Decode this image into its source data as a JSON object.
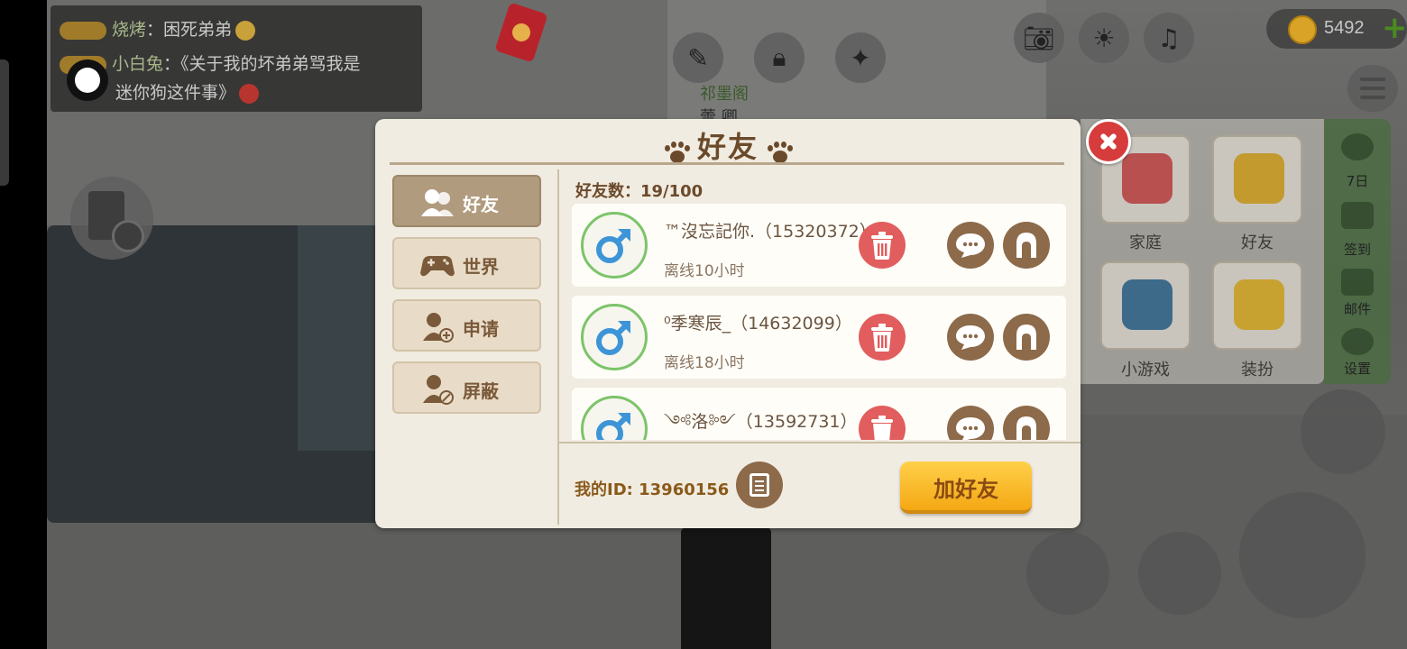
{
  "chat": {
    "line1_name": "烧烤",
    "line1_sep": "：",
    "line1_text": "困死弟弟",
    "line2_name": "小白兔",
    "line2_sep": "：",
    "line2_text": "《关于我的坏弟弟骂我是",
    "line3_text": "迷你狗这件事》"
  },
  "hud": {
    "coins": "5492",
    "plus": "+",
    "bg_label_1": "祁墨阁",
    "bg_label_2": "蕾 卿"
  },
  "right_menu": {
    "tiles": [
      {
        "label": "家庭",
        "icon": "heart-icon"
      },
      {
        "label": "好友",
        "icon": "friends-icon"
      },
      {
        "label": "小游戏",
        "icon": "gamepad-icon"
      },
      {
        "label": "装扮",
        "icon": "star-wand-icon"
      }
    ],
    "side": [
      {
        "label": "7日",
        "icon": "seven-day-icon"
      },
      {
        "label": "签到",
        "icon": "calendar-icon"
      },
      {
        "label": "邮件",
        "icon": "mail-icon"
      },
      {
        "label": "设置",
        "icon": "settings-icon"
      }
    ]
  },
  "dialog": {
    "title": "好友",
    "tabs": [
      {
        "label": "好友",
        "icon": "friends-icon",
        "active": true
      },
      {
        "label": "世界",
        "icon": "gamepad-icon",
        "active": false
      },
      {
        "label": "申请",
        "icon": "add-person-icon",
        "active": false
      },
      {
        "label": "屏蔽",
        "icon": "block-person-icon",
        "active": false
      }
    ],
    "friend_count_label": "好友数：",
    "friend_count": "19/100",
    "friends": [
      {
        "name": "™沒忘記你.（15320372）",
        "status": "离线10小时",
        "gender_icon": "male-icon"
      },
      {
        "name": "⁰季寒辰_（14632099）",
        "status": "离线18小时",
        "gender_icon": "male-icon"
      },
      {
        "name": "༺洛༻（13592731）",
        "status": "",
        "gender_icon": "male-icon"
      }
    ],
    "my_id_label": "我的ID:",
    "my_id": "13960156",
    "add_friend_label": "加好友"
  },
  "colors": {
    "title_brown": "#6b4a2b",
    "tab_active": "#b19b7e",
    "delete_red": "#e25d5d",
    "action_brown": "#8c6a4a",
    "add_button_yellow": "#f4a814",
    "avatar_ring_green": "#7cc46a",
    "male_blue": "#3d95d8"
  }
}
